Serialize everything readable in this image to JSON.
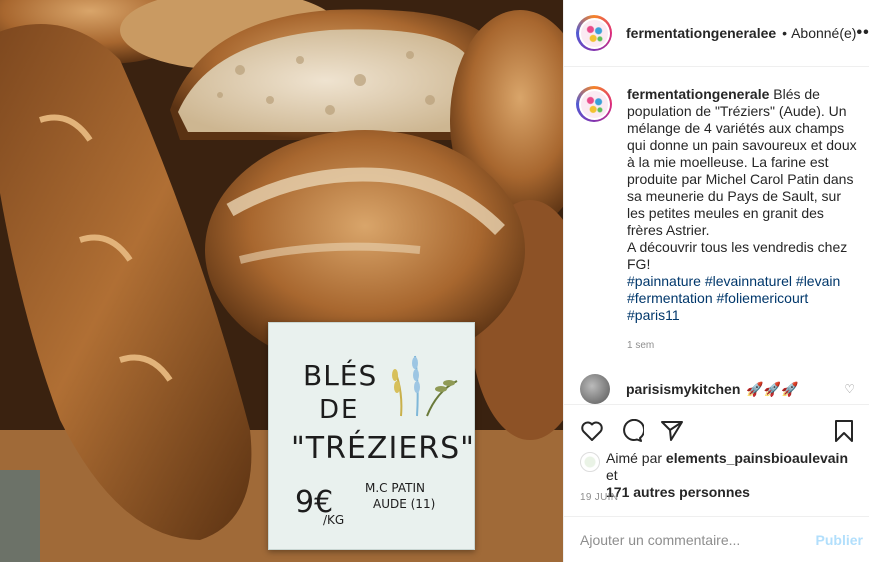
{
  "photo": {
    "sign": {
      "line1": "BLÉS",
      "line2": "DE",
      "line3": "\"TRÉZIERS\"",
      "line4": "M.C PATIN",
      "line5": "AUDE (11)",
      "price": "9€",
      "unit": "/KG"
    }
  },
  "header": {
    "username": "fermentationgeneralee",
    "separator": "•",
    "follow_status": "Abonné(e)",
    "more_icon": "more-horizontal-icon"
  },
  "caption": {
    "username": "fermentationgenerale",
    "text": "Blés de population de \"Tréziers\" (Aude). Un mélange de 4 variétés aux champs qui donne un pain savoureux et doux à la mie moelleuse. La farine est produite par Michel Carol Patin dans sa meunerie du Pays de Sault, sur les petites meules en granit des frères Astrier.",
    "text2": "A découvrir tous les vendredis chez FG!",
    "hashtags": "#painnature #levainnaturel #levain #fermentation #foliemericourt #paris11",
    "time": "1 sem"
  },
  "comment": {
    "username": "parisismykitchen",
    "text": "🚀🚀🚀",
    "heart_icon": "heart-outline-icon"
  },
  "actions": {
    "icons": [
      "heart-icon",
      "comment-icon",
      "share-icon",
      "bookmark-icon"
    ]
  },
  "likes": {
    "prefix": "Aimé par",
    "user": "elements_painsbioaulevain",
    "middle": "et",
    "others": "171 autres personnes"
  },
  "date": "19 JUIN",
  "add_comment": {
    "placeholder": "Ajouter un commentaire...",
    "post_label": "Publier"
  },
  "colors": {
    "link": "#00376b",
    "muted": "#8e8e8e",
    "post_disabled": "#b2dffc"
  }
}
